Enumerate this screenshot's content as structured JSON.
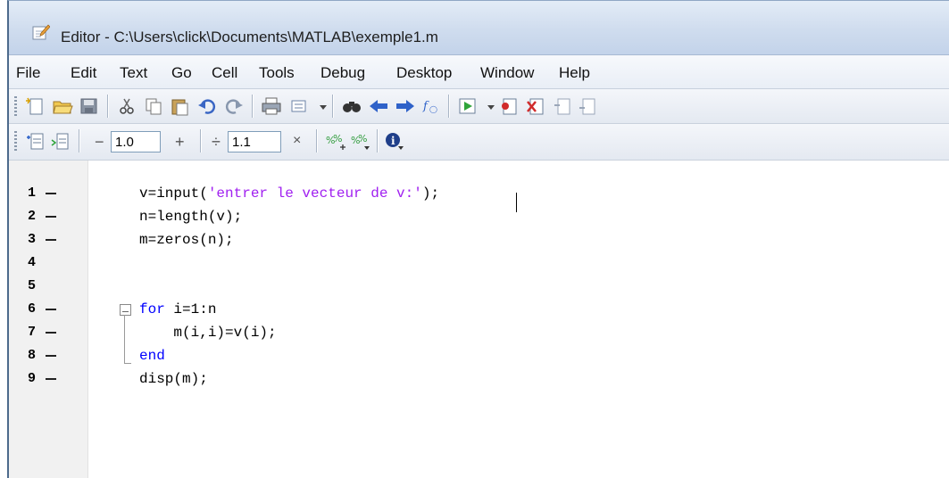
{
  "window": {
    "title": "Editor - C:\\Users\\click\\Documents\\MATLAB\\exemple1.m",
    "icon": "editor-document-icon"
  },
  "menu": [
    "File",
    "Edit",
    "Text",
    "Go",
    "Cell",
    "Tools",
    "Debug",
    "Desktop",
    "Window",
    "Help"
  ],
  "toolbar1": {
    "icons": [
      "new-file-icon",
      "open-folder-icon",
      "save-icon",
      "cut-icon",
      "copy-icon",
      "paste-icon",
      "undo-icon",
      "redo-icon",
      "print-icon",
      "comment-icon",
      "find-icon",
      "back-arrow-icon",
      "forward-arrow-icon",
      "function-icon",
      "run-icon",
      "set-breakpoint-icon",
      "clear-breakpoint-icon",
      "step-icon",
      "step-in-icon"
    ]
  },
  "toolbar2": {
    "decrement_label": "−",
    "first_value": "1.0",
    "increment_label": "+",
    "divide_label": "÷",
    "second_value": "1.1",
    "multiply_label": "×"
  },
  "code": [
    {
      "num": "1",
      "breakpoint": true,
      "parts": [
        {
          "t": "v=input(",
          "c": ""
        },
        {
          "t": "'entrer le vecteur de v:'",
          "c": "str"
        },
        {
          "t": ");",
          "c": ""
        }
      ]
    },
    {
      "num": "2",
      "breakpoint": true,
      "parts": [
        {
          "t": "n=length(v);",
          "c": ""
        }
      ]
    },
    {
      "num": "3",
      "breakpoint": true,
      "parts": [
        {
          "t": "m=zeros(n);",
          "c": ""
        }
      ]
    },
    {
      "num": "4",
      "breakpoint": false,
      "parts": []
    },
    {
      "num": "5",
      "breakpoint": false,
      "parts": []
    },
    {
      "num": "6",
      "breakpoint": true,
      "parts": [
        {
          "t": "for",
          "c": "kw"
        },
        {
          "t": " i=1:n",
          "c": ""
        }
      ]
    },
    {
      "num": "7",
      "breakpoint": true,
      "parts": [
        {
          "t": "    m(i,i)=v(i);",
          "c": ""
        }
      ]
    },
    {
      "num": "8",
      "breakpoint": true,
      "parts": [
        {
          "t": "end",
          "c": "kw"
        }
      ]
    },
    {
      "num": "9",
      "breakpoint": true,
      "parts": [
        {
          "t": "disp(m);",
          "c": ""
        }
      ]
    }
  ],
  "colors": {
    "keyword": "#0000ff",
    "string": "#a020f0",
    "text": "#000000"
  }
}
